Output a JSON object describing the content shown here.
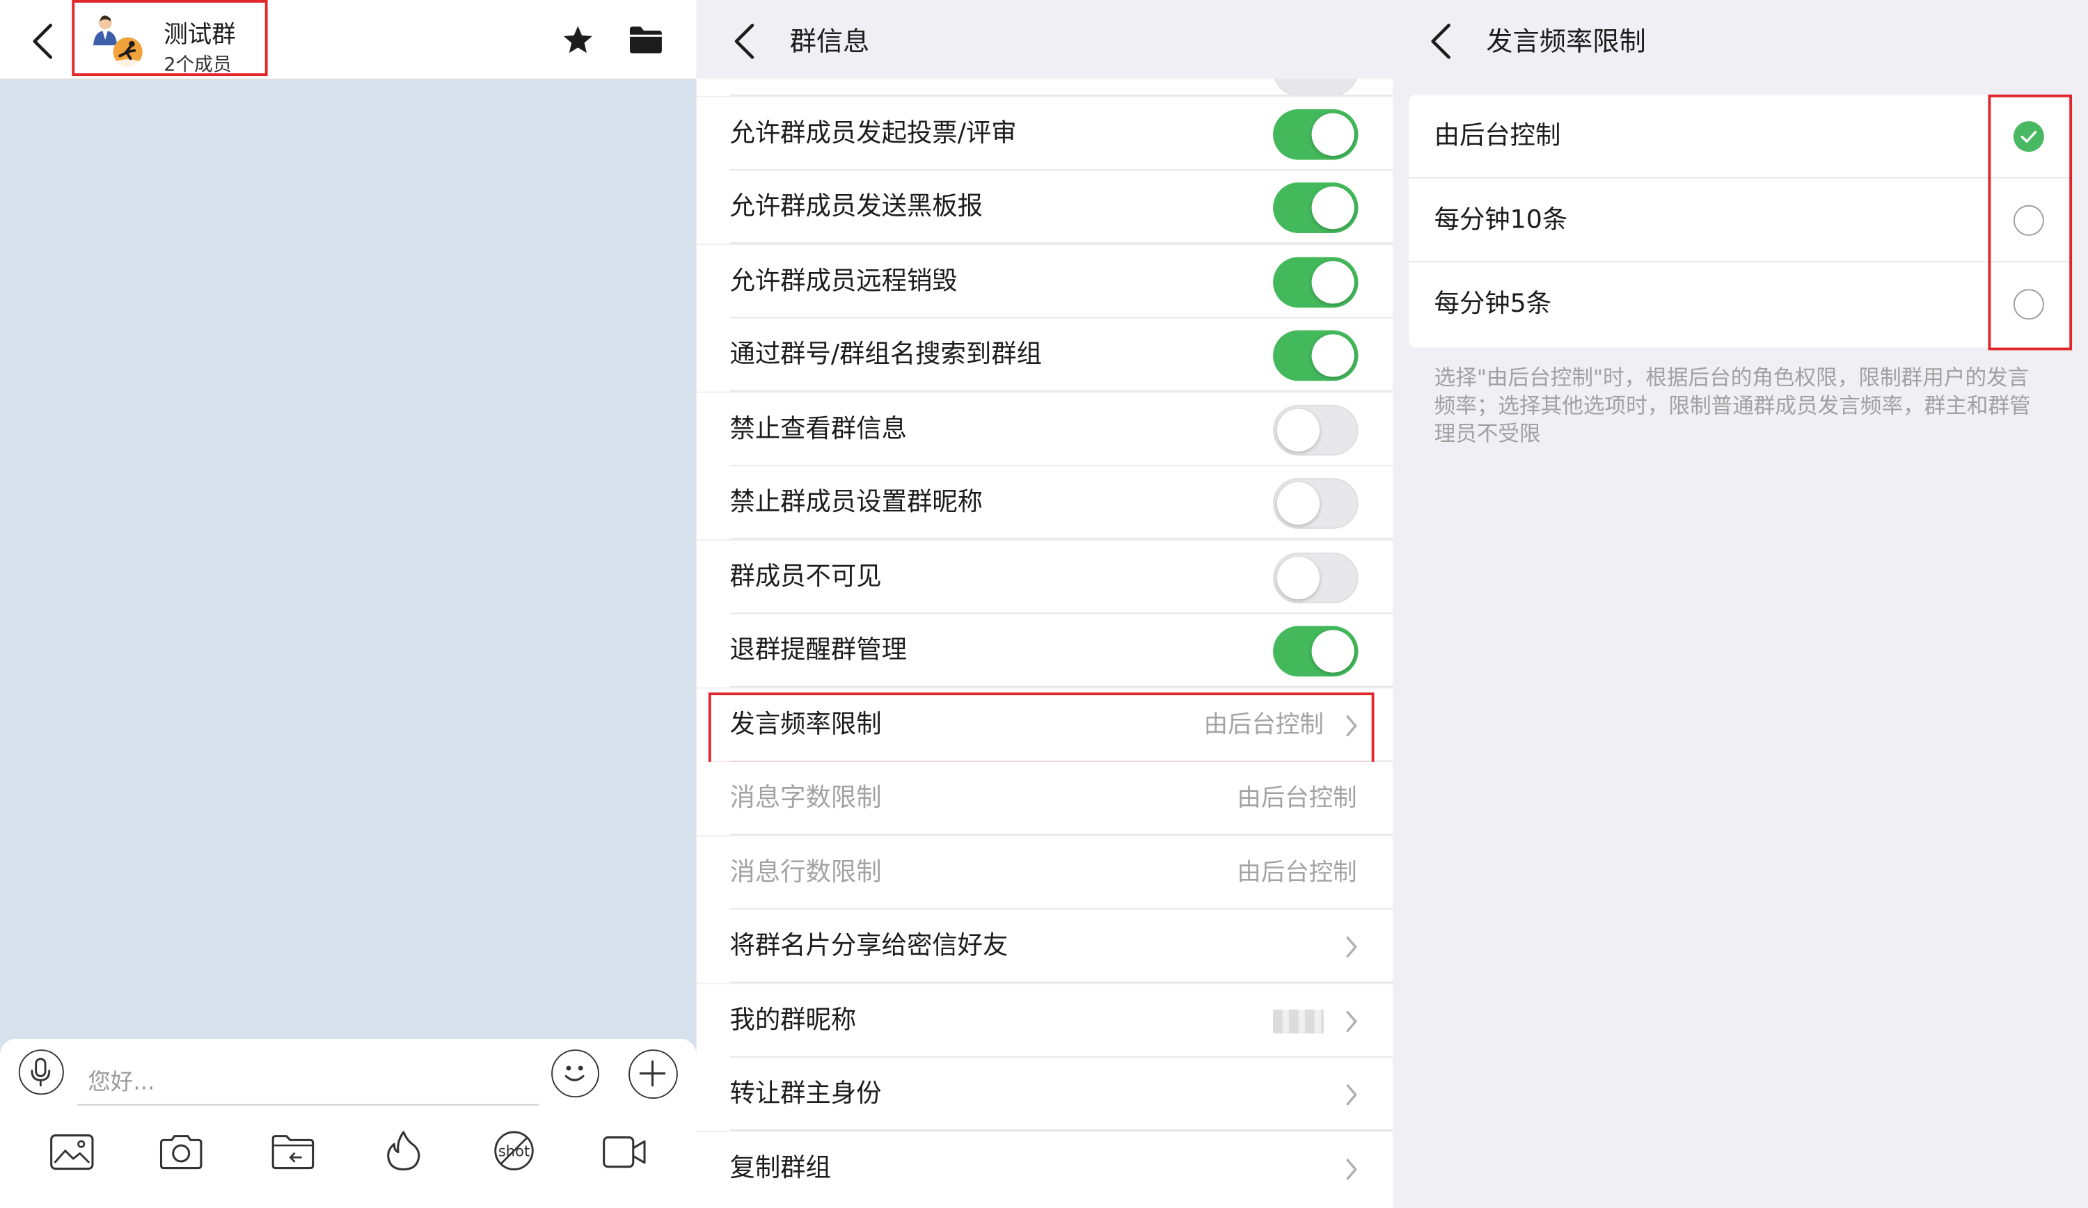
{
  "chat": {
    "group_name": "测试群",
    "member_count": "2个成员",
    "input_placeholder": "您好..."
  },
  "group_info": {
    "title": "群信息",
    "settings": [
      {
        "label": "允许群成员发起投票/评审",
        "toggle": "on"
      },
      {
        "label": "允许群成员发送黑板报",
        "toggle": "on"
      },
      {
        "label": "允许群成员远程销毁",
        "toggle": "on"
      },
      {
        "label": "通过群号/群组名搜索到群组",
        "toggle": "on"
      },
      {
        "label": "禁止查看群信息",
        "toggle": "off"
      },
      {
        "label": "禁止群成员设置群昵称",
        "toggle": "off"
      },
      {
        "label": "群成员不可见",
        "toggle": "off"
      },
      {
        "label": "退群提醒群管理",
        "toggle": "on"
      }
    ],
    "speak_freq": {
      "label": "发言频率限制",
      "value": "由后台控制"
    },
    "msg_chars": {
      "label": "消息字数限制",
      "value": "由后台控制"
    },
    "msg_lines": {
      "label": "消息行数限制",
      "value": "由后台控制"
    },
    "share_card": {
      "label": "将群名片分享给密信好友"
    },
    "my_nickname": {
      "label": "我的群昵称"
    },
    "transfer_owner": {
      "label": "转让群主身份"
    },
    "copy_group": {
      "label": "复制群组"
    }
  },
  "freq_limit": {
    "title": "发言频率限制",
    "options": [
      {
        "label": "由后台控制",
        "selected": true
      },
      {
        "label": "每分钟10条",
        "selected": false
      },
      {
        "label": "每分钟5条",
        "selected": false
      }
    ],
    "note": "选择\"由后台控制\"时，根据后台的角色权限，限制群用户的发言频率；选择其他选项时，限制普通群成员发言频率，群主和群管理员不受限"
  },
  "colors": {
    "toggle_on": "#43b95b",
    "highlight_box": "#e0262b",
    "chat_bg": "#d6e1ec"
  }
}
